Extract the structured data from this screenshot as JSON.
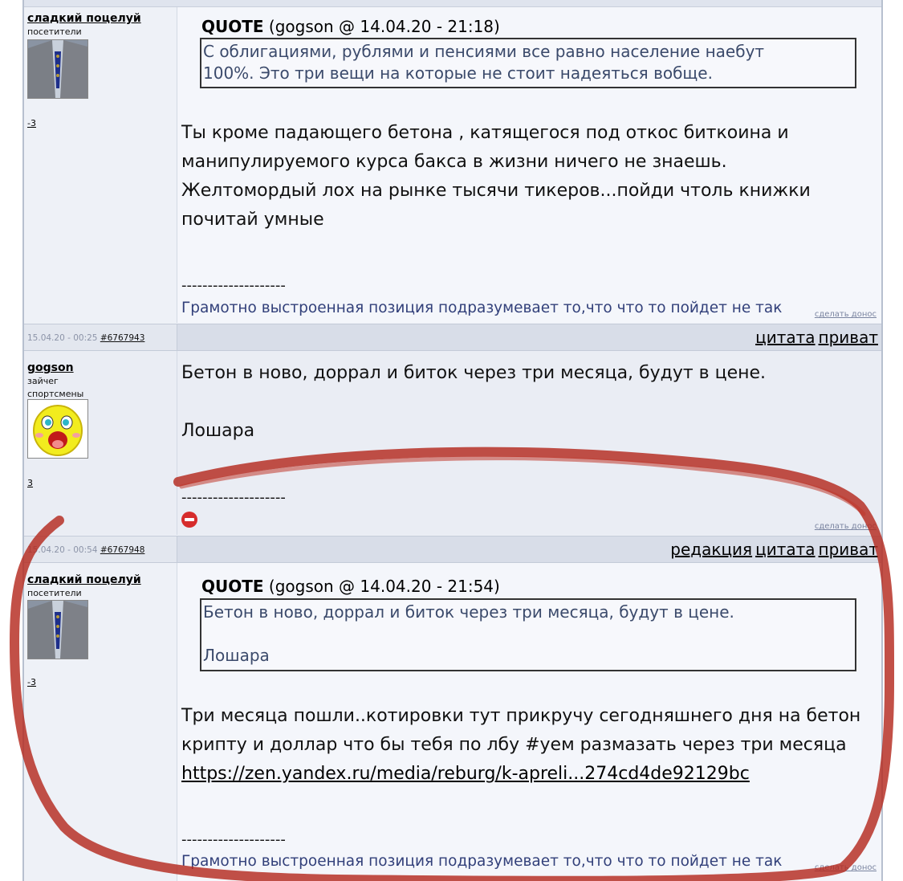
{
  "posts": [
    {
      "author": "сладкий поцелуй",
      "group": "посетители",
      "rep": "-3",
      "quote_label": "QUOTE",
      "quote_meta": "(gogson @ 14.04.20 - 21:18)",
      "quote_lines": [
        "С облигациями, рублями и пенсиями все равно население наебут",
        "100%. Это три вещи на которые не стоит надеяться вобще."
      ],
      "text_lines": [
        "Ты кроме падающего бетона , катящегося под откос биткоина и",
        "манипулируемого курса бакса в жизни ничего не знаешь.",
        "Желтомордый лох на рынке тысячи тикеров...пойди чтоль книжки",
        "почитай умные"
      ],
      "separator": "--------------------",
      "signature": "Грамотно выстроенная позиция подразумевает то,что что то пойдет не так",
      "report": "сделать донос",
      "date": "15.04.20 - 00:25",
      "post_id": "#6767943",
      "actions": [
        "цитата",
        "приват"
      ]
    },
    {
      "author": "gogson",
      "group1": "зайчег",
      "group2": "спортсмены",
      "rep": "3",
      "text_lines": [
        "Бетон в ново, доррал и биток через три месяца, будут в цене.",
        "",
        "Лошара"
      ],
      "separator": "--------------------",
      "report": "сделать донос",
      "date": "15.04.20 - 00:54",
      "post_id": "#6767948",
      "actions": [
        "редакция",
        "цитата",
        "приват"
      ]
    },
    {
      "author": "сладкий поцелуй",
      "group": "посетители",
      "rep": "-3",
      "quote_label": "QUOTE",
      "quote_meta": "(gogson @ 14.04.20 - 21:54)",
      "quote_lines": [
        "Бетон в ново, доррал и биток через три месяца, будут в цене.",
        "",
        "Лошара"
      ],
      "text_lines": [
        "Три месяца пошли..котировки тут прикручу сегодняшнего дня на бетон",
        "крипту и доллар что бы тебя по лбу #уем размазать через три месяца"
      ],
      "link": "https://zen.yandex.ru/media/reburg/k-apreli...274cd4de92129bc",
      "separator": "--------------------",
      "signature": "Грамотно выстроенная позиция подразумевает то,что что то пойдет не так",
      "report": "сделать донос"
    }
  ],
  "colors": {
    "annotation": "#b52a1e",
    "signature": "#32407a",
    "quote_text": "#3b4a6b"
  },
  "icons": {
    "forbidden": "no-entry-icon"
  }
}
